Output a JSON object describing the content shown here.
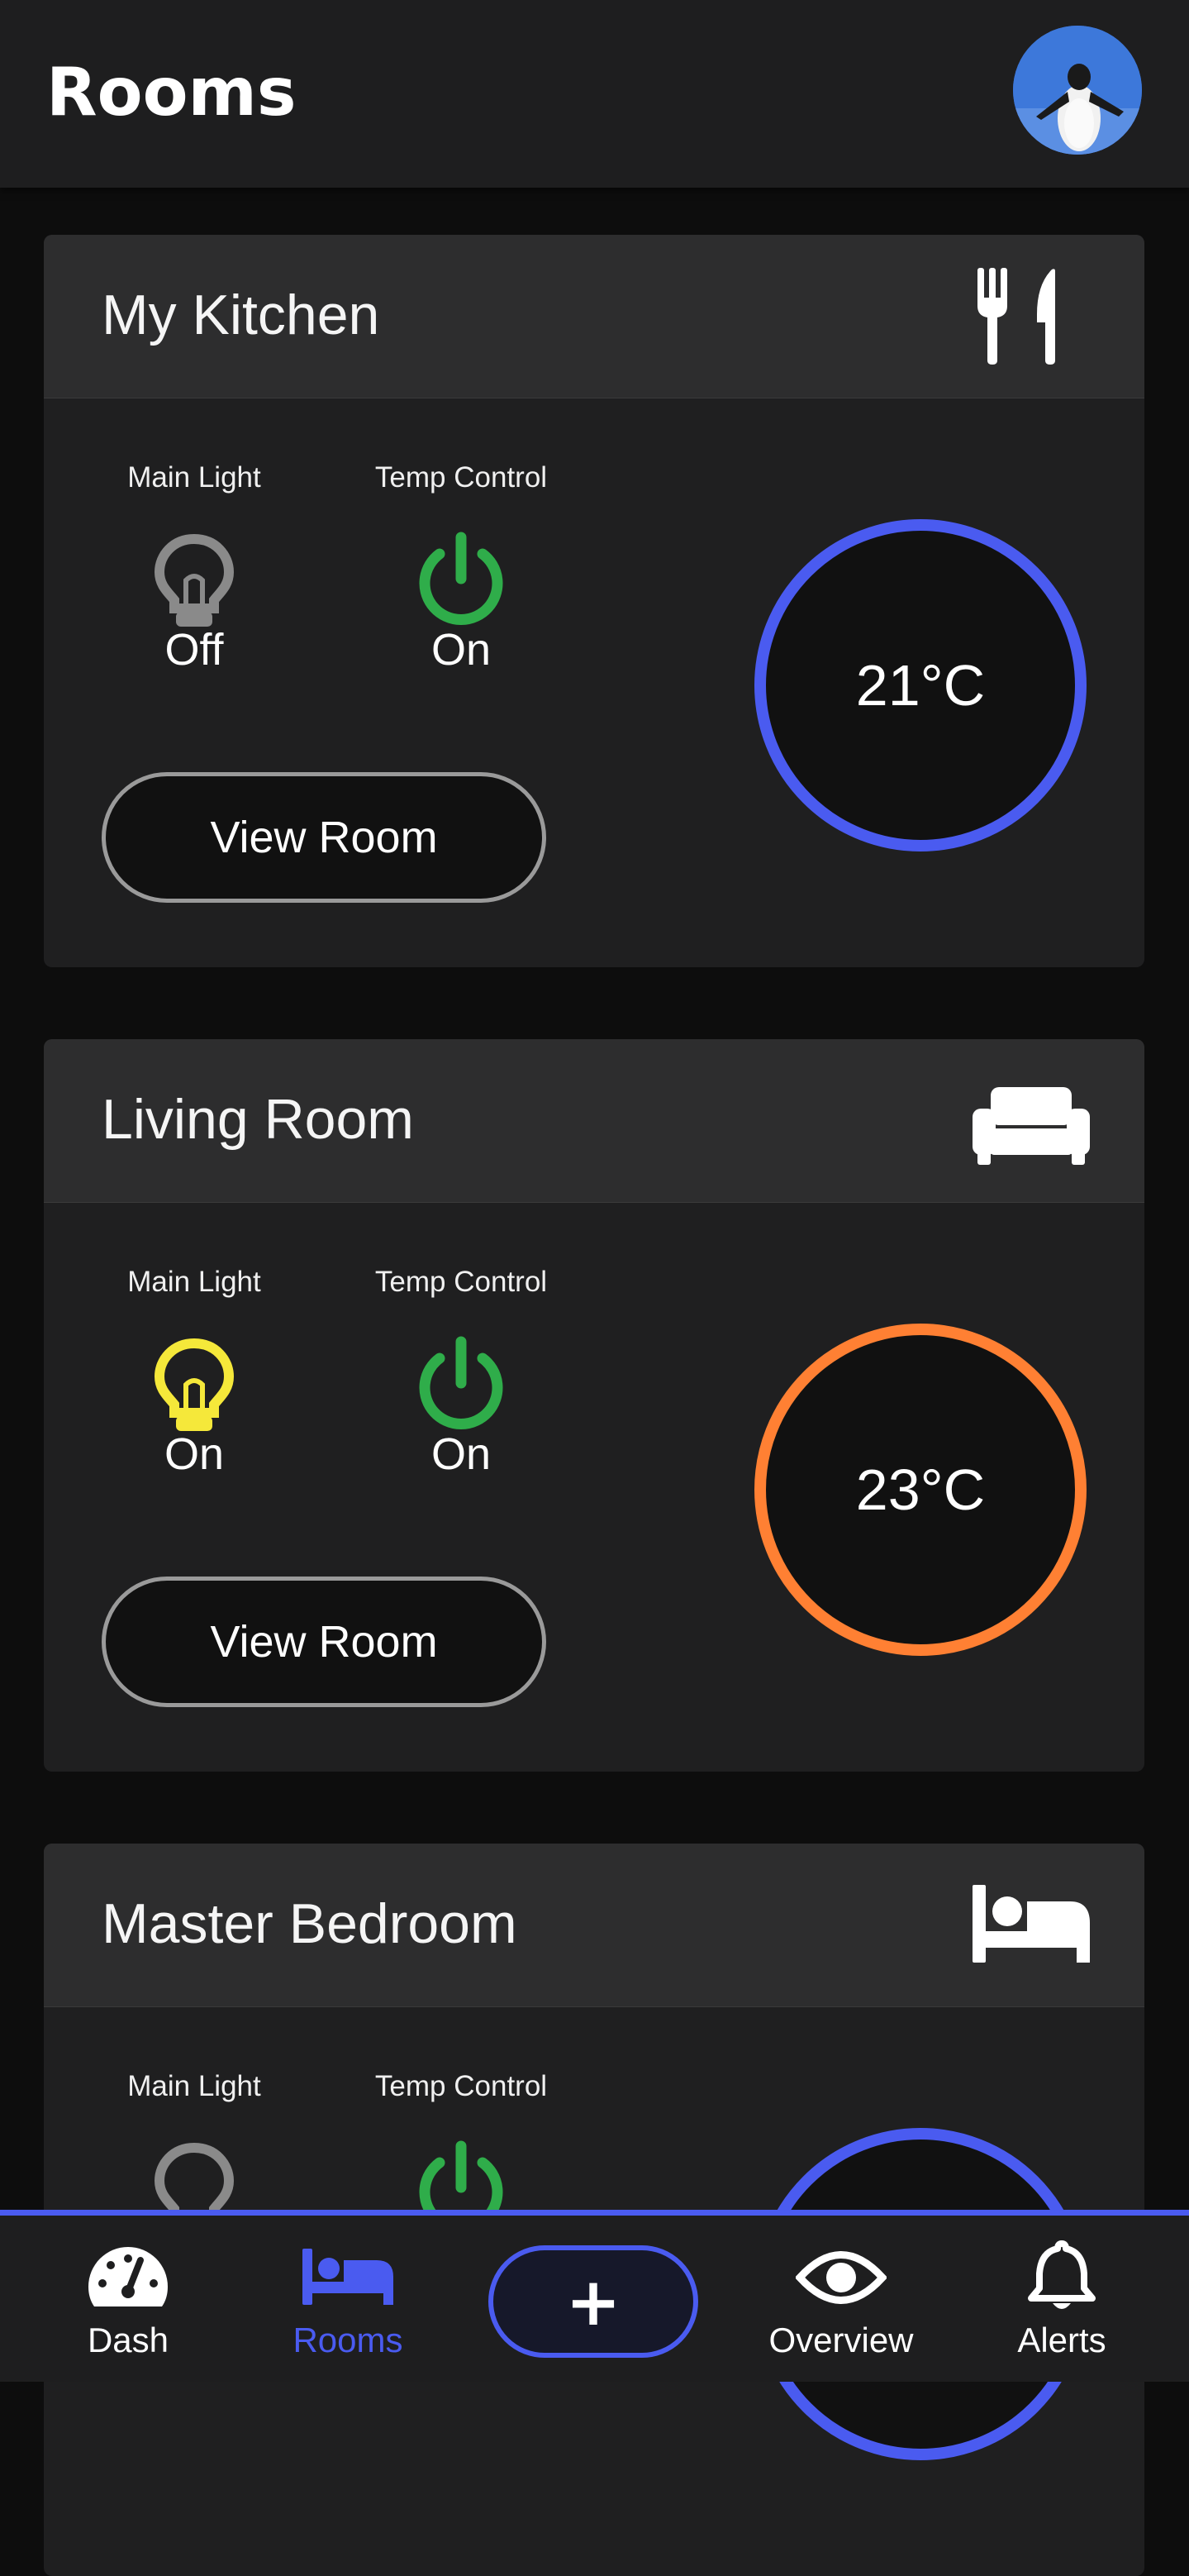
{
  "header": {
    "title": "Rooms"
  },
  "rooms": [
    {
      "name": "My Kitchen",
      "icon": "cutlery-icon",
      "main_light_label": "Main Light",
      "main_light_state": "Off",
      "temp_control_label": "Temp Control",
      "temp_control_state": "On",
      "view_label": "View Room",
      "temperature": "21°C",
      "ring_color": "#4a5bf0",
      "light_color": "#8a8a8a"
    },
    {
      "name": "Living Room",
      "icon": "sofa-icon",
      "main_light_label": "Main Light",
      "main_light_state": "On",
      "temp_control_label": "Temp Control",
      "temp_control_state": "On",
      "view_label": "View Room",
      "temperature": "23°C",
      "ring_color": "#ff8033",
      "light_color": "#f5e83a"
    },
    {
      "name": "Master Bedroom",
      "icon": "bed-icon",
      "main_light_label": "Main Light",
      "temp_control_label": "Temp Control",
      "ring_color": "#4a5bf0",
      "light_color": "#8a8a8a"
    }
  ],
  "nav": {
    "items": [
      {
        "label": "Dash",
        "icon": "dashboard-gauge-icon"
      },
      {
        "label": "Rooms",
        "icon": "bed-icon",
        "active": true
      },
      {
        "label": "+",
        "icon": "add-icon"
      },
      {
        "label": "Overview",
        "icon": "eye-icon"
      },
      {
        "label": "Alerts",
        "icon": "bell-icon"
      }
    ],
    "active_color": "#4a5bf0"
  },
  "colors": {
    "accent": "#4a5bf0",
    "power_on": "#2fad4a"
  }
}
